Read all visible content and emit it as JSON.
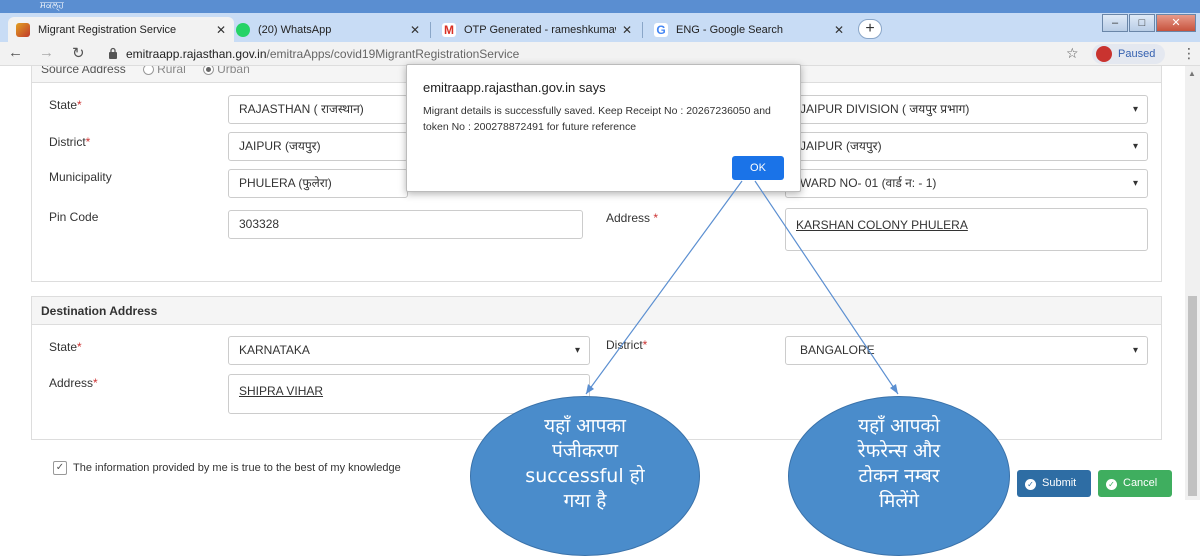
{
  "browser": {
    "strip_text": "ਸਕਲ੍ਹ",
    "tabs": [
      {
        "label": "Migrant Registration Service",
        "close": "✕",
        "active": true
      },
      {
        "label": "(20) WhatsApp",
        "close": "✕",
        "active": false
      },
      {
        "label": "OTP Generated - rameshkumawa",
        "close": "✕",
        "active": false
      },
      {
        "label": "ENG - Google Search",
        "close": "✕",
        "active": false
      }
    ],
    "new_tab": "+",
    "url_host": "emitraapp.rajasthan.gov.in",
    "url_path": "/emitraApps/covid19MigrantRegistrationService",
    "profile_status": "Paused",
    "colors": {
      "tabbar": "#c8dcf5",
      "accent": "#1a73e8"
    }
  },
  "source_section": {
    "title": "Source Address",
    "radio_rural": "Rural",
    "radio_urban": "Urban",
    "selected": "Urban",
    "state_label": "State",
    "state_value": "RAJASTHAN ( राजस्थान)",
    "district_label": "District",
    "district_value": "JAIPUR (जयपुर)",
    "municipality_label": "Municipality",
    "municipality_value": "PHULERA (फुलेरा)",
    "division_value": "JAIPUR DIVISION ( जयपुर प्रभाग)",
    "district2_value": "JAIPUR (जयपुर)",
    "ward_value": "WARD NO- 01 (वार्ड न: - 1)",
    "pin_label": "Pin Code",
    "pin_value": "303328",
    "address_label": "Address",
    "address_value": "KARSHAN COLONY PHULERA"
  },
  "destination_section": {
    "title": "Destination Address",
    "state_label": "State",
    "state_value": "KARNATAKA",
    "district_label": "District",
    "district_value": "BANGALORE",
    "address_label": "Address",
    "address_value": "SHIPRA VIHAR"
  },
  "required_mark": "*",
  "dialog": {
    "title": "emitraapp.rajasthan.gov.in says",
    "message": "Migrant details is successfully saved. Keep Receipt No : 20267236050 and token No : 200278872491 for future reference",
    "ok_label": "OK"
  },
  "footer": {
    "declaration": "The information provided by me is true to the best of my knowledge",
    "submit_label": "Submit",
    "cancel_label": "Cancel"
  },
  "callouts": {
    "left_lines": [
      "यहाँ आपका",
      "पंजीकरण",
      "successful हो",
      "गया है"
    ],
    "right_lines": [
      "यहाँ आपको",
      "रेफरेन्स और",
      "टोकन नम्बर",
      "मिलेंगे"
    ]
  }
}
